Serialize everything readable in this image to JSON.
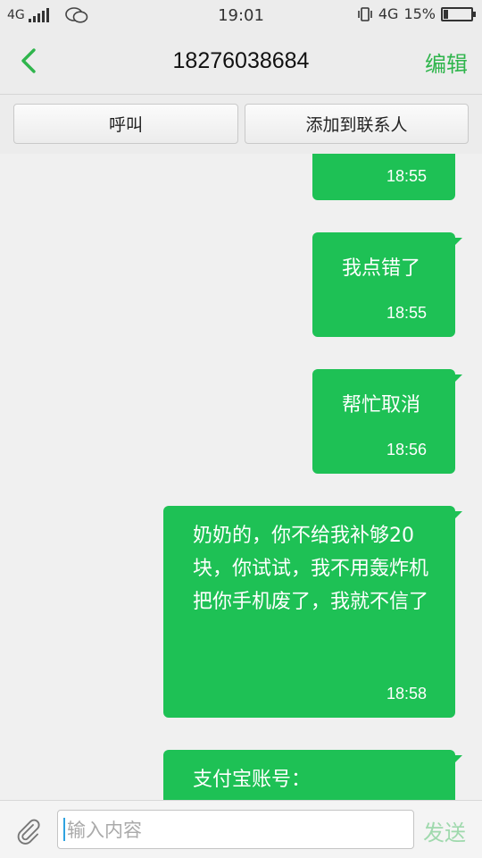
{
  "status_bar": {
    "network": "4G",
    "time": "19:01",
    "network_right": "4G",
    "battery_text": "15%",
    "battery_level": 0.15
  },
  "header": {
    "title": "18276038684",
    "edit_label": "编辑"
  },
  "actions": {
    "call_label": "呼叫",
    "add_contact_label": "添加到联系人"
  },
  "messages": [
    {
      "text": "",
      "time": "18:55"
    },
    {
      "text": "我点错了",
      "time": "18:55"
    },
    {
      "text": "帮忙取消",
      "time": "18:56"
    },
    {
      "text": "奶奶的，你不给我补够20块，你试试，我不用轰炸机把你手机废了，我就不信了",
      "time": "18:58"
    },
    {
      "text": "支付宝账号：",
      "time": ""
    }
  ],
  "composer": {
    "placeholder": "输入内容",
    "send_label": "发送"
  },
  "colors": {
    "bubble": "#1ec155",
    "accent": "#2fb54c"
  }
}
